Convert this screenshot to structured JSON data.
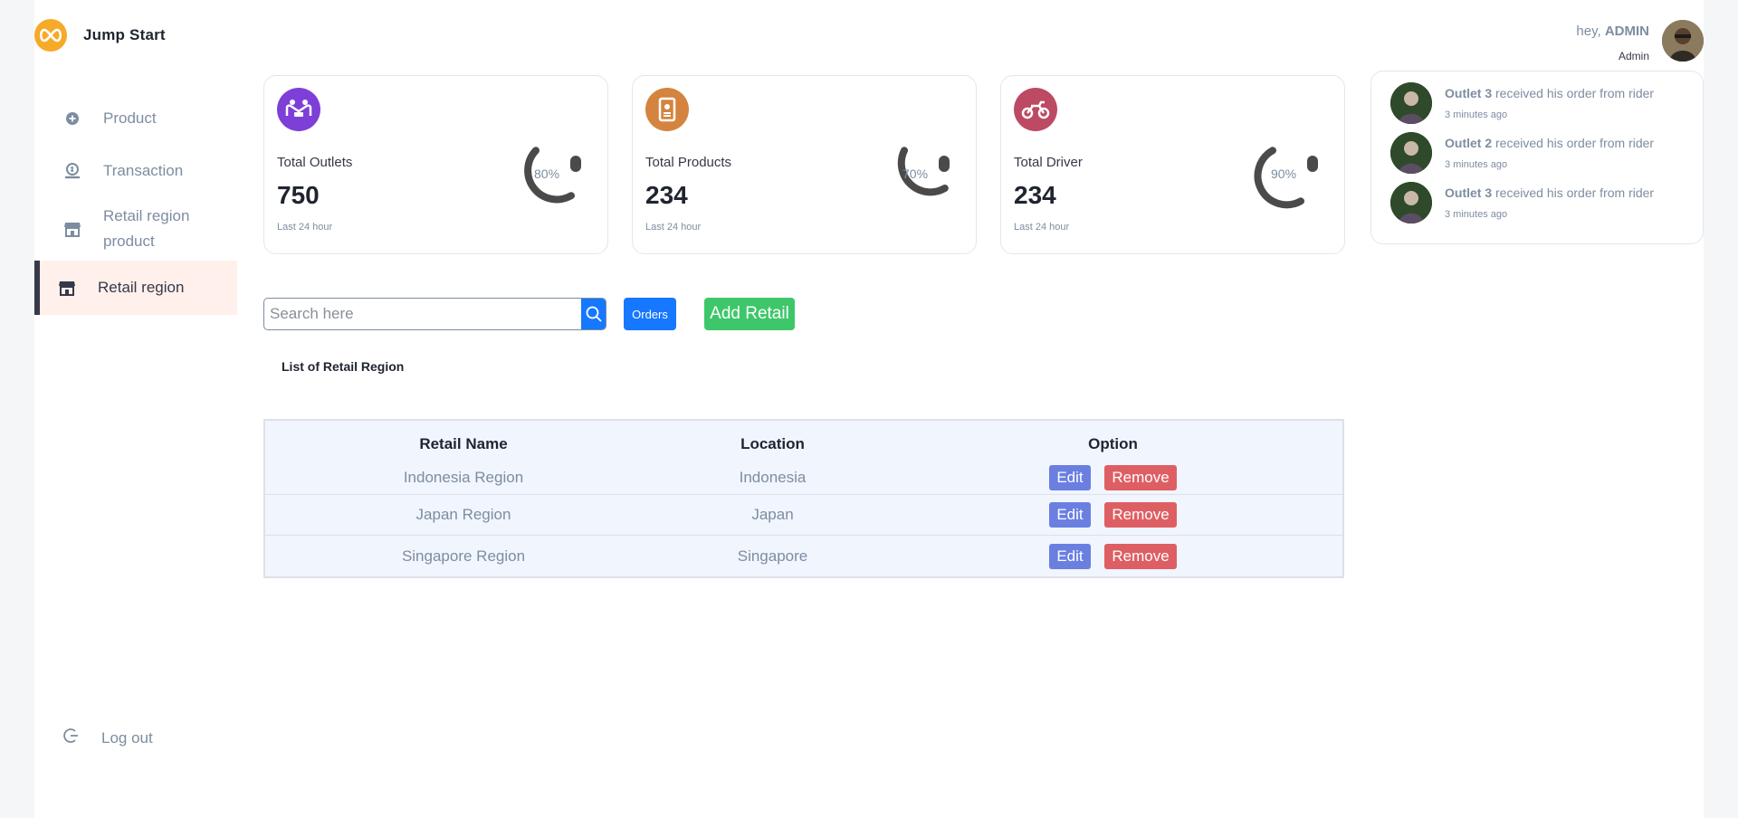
{
  "app": {
    "name": "Jump Start"
  },
  "sidebar": {
    "items": [
      {
        "label": "Product",
        "icon": "plus-circle-icon"
      },
      {
        "label": "Transaction",
        "icon": "money-hand-icon"
      },
      {
        "label": "Retail region product",
        "icon": "store-icon"
      },
      {
        "label": "Retail region",
        "icon": "store-icon",
        "active": true
      }
    ],
    "logout_label": "Log out"
  },
  "header": {
    "greeting": "hey, ",
    "username": "ADMIN",
    "role": "Admin"
  },
  "cards": [
    {
      "title": "Total Outlets",
      "value": "750",
      "sub": "Last 24 hour",
      "percent": "80%",
      "fraction": 0.8,
      "color": "#7d3fd8",
      "icon": "handshake-icon"
    },
    {
      "title": "Total Products",
      "value": "234",
      "sub": "Last 24 hour",
      "percent": "70%",
      "fraction": 0.7,
      "color": "#d4843f",
      "icon": "phone-icon"
    },
    {
      "title": "Total Driver",
      "value": "234",
      "sub": "Last 24 hour",
      "percent": "90%",
      "fraction": 0.9,
      "color": "#bc4a63",
      "icon": "motorcycle-icon"
    }
  ],
  "updates": [
    {
      "name": "Outlet 3",
      "text": " received his order from rider",
      "time": "3 minutes ago"
    },
    {
      "name": "Outlet 2",
      "text": " received his order from rider",
      "time": "3 minutes ago"
    },
    {
      "name": "Outlet 3",
      "text": " received his order from rider",
      "time": "3 minutes ago"
    }
  ],
  "toolbar": {
    "search_placeholder": "Search here",
    "orders_label": "Orders",
    "add_label": "Add Retail"
  },
  "list_title": "List of Retail Region",
  "table": {
    "headers": [
      "Retail Name",
      "Location",
      "Option"
    ],
    "rows": [
      {
        "name": "Indonesia Region",
        "location": "Indonesia"
      },
      {
        "name": "Japan Region",
        "location": "Japan"
      },
      {
        "name": "Singapore Region",
        "location": "Singapore"
      }
    ],
    "edit_label": "Edit",
    "remove_label": "Remove"
  }
}
